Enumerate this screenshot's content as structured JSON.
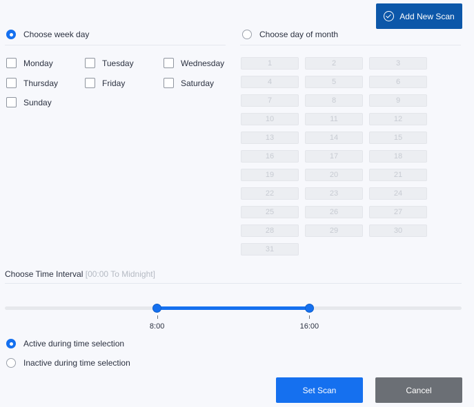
{
  "header": {
    "add_scan_label": "Add New Scan"
  },
  "weekday": {
    "label": "Choose week day",
    "selected": true,
    "days": [
      "Monday",
      "Tuesday",
      "Wednesday",
      "Thursday",
      "Friday",
      "Saturday",
      "Sunday"
    ]
  },
  "monthday": {
    "label": "Choose day of month",
    "selected": false,
    "days": [
      "1",
      "2",
      "3",
      "4",
      "5",
      "6",
      "7",
      "8",
      "9",
      "10",
      "11",
      "12",
      "13",
      "14",
      "15",
      "16",
      "17",
      "18",
      "19",
      "20",
      "21",
      "22",
      "23",
      "24",
      "25",
      "26",
      "27",
      "28",
      "29",
      "30",
      "31"
    ]
  },
  "time_interval": {
    "label": "Choose Time Interval",
    "hint": "[00:00 To Midnight]",
    "start": "8:00",
    "end": "16:00",
    "start_fraction": 0.3333,
    "end_fraction": 0.6667
  },
  "mode": {
    "active_label": "Active during time selection",
    "inactive_label": "Inactive during time selection",
    "selected": "active"
  },
  "actions": {
    "set_label": "Set Scan",
    "cancel_label": "Cancel"
  },
  "colors": {
    "primary": "#1570ef",
    "header_button": "#0c57a9",
    "cancel": "#6b6f75"
  }
}
